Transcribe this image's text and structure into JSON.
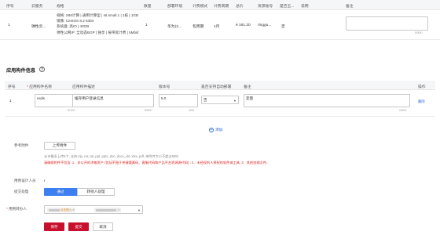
{
  "top_table": {
    "headers": [
      "序号",
      "云服务",
      "规格",
      "数量",
      "部署环境",
      "计费模式",
      "计费周期",
      "总价",
      "资源账号",
      "是否五...",
      "说明",
      "备注"
    ],
    "row": {
      "index": "1",
      "service": "弹性云...",
      "spec_lines": [
        "规格: X86计算 | 通用计算型 | s6.small.1 | 1核 | 1GB",
        "镜像: CentOS 8.2 64bit",
        "系统盘: 高IO | 40GB",
        "弹性公网IP: 全动态BGP | 独享 | 按带宽计费 | 5Mbit/"
      ],
      "quantity": "1",
      "env": "华为(2...",
      "billing_mode": "包周期",
      "billing_period": "1月",
      "total": "¥ 161.20",
      "account": "ringgu...",
      "is_five": "否",
      "note_counter": "0/500"
    }
  },
  "app_section": {
    "title": "应用构件信息",
    "headers": [
      "序号",
      "应用构件名称",
      "应用构件描述",
      "版本号",
      "是否支持自动部署",
      "备注",
      "操作"
    ],
    "row": {
      "index": "1",
      "name": "redis",
      "name_counter": "5/100",
      "desc": "缓存用户登录信息",
      "desc_counter": "8/500",
      "version": "5.0",
      "version_counter": "3/50",
      "auto_deploy": "否",
      "remark": "定量",
      "remark_counter": "2/500",
      "action": "删除"
    },
    "add_label": "添加"
  },
  "attachment": {
    "label": "参考附件",
    "upload_label": "上传附件",
    "hint": "允许最多上传5个, 支持.zip,.rar,.tar,.ppt,.pptx,.doc,.docx,.xls,.xlsx,.pdf, 单附件大小不超过50M",
    "warning": "请确保附件不包含: 1、非公开的涉敏资产 (包括不限于关键要素码、客服代码和产品平台资源源代码) ; 2、未经权利人授权的软件或工具; 3、其他违规文件。"
  },
  "handler_label": "用例设计人员",
  "handler_value": "r",
  "submit_handling": {
    "label": "提交处理",
    "options": [
      "通过",
      "转他人处理"
    ],
    "selected": "通过"
  },
  "processor": {
    "label": "用例转办人",
    "tags": [
      {
        "text": "从业授入"
      },
      {
        "text": ""
      }
    ]
  },
  "actions": {
    "save": "保存",
    "submit": "提交",
    "cancel": "取消"
  },
  "colors": {
    "primary_red": "#c8102e",
    "link_blue": "#2f6bd8",
    "segment_blue": "#3b7ff0",
    "warning_red": "#e02020"
  }
}
